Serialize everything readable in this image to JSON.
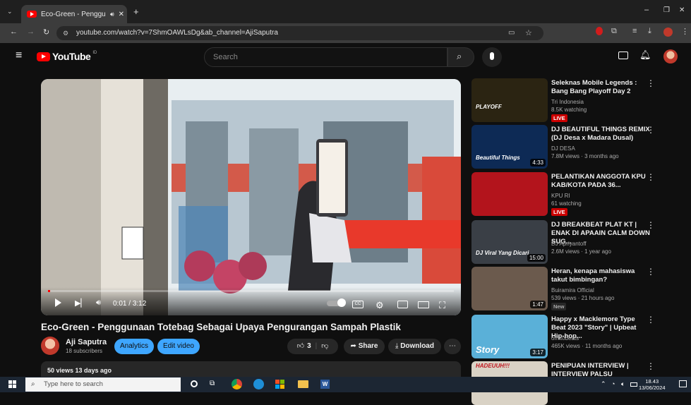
{
  "browser": {
    "tab_title": "Eco-Green - Penggunaan T",
    "url": "youtube.com/watch?v=7ShmOAWLsDg&ab_channel=AjiSaputra"
  },
  "youtube": {
    "logo_text": "YouTube",
    "logo_region": "ID",
    "search_placeholder": "Search"
  },
  "player": {
    "time_current": "0:01",
    "time_total": "3:12",
    "progress_fraction": 0.005
  },
  "video": {
    "title": "Eco-Green - Penggunaan Totebag Sebagai Upaya Pengurangan Sampah Plastik",
    "channel": "Aji Saputra",
    "subscribers": "18 subscribers",
    "analytics_label": "Analytics",
    "edit_label": "Edit video",
    "like_count": "3",
    "share_label": "Share",
    "download_label": "Download",
    "views_date": "50 views  13 days ago"
  },
  "sidebar": [
    {
      "title": "Seleknas Mobile Legends : Bang Bang Playoff Day 2",
      "channel": "Tri Indonesia",
      "stats": "8.5K watching",
      "badge": "LIVE",
      "badge_type": "live",
      "duration": "",
      "thumb_color": "#2b2412"
    },
    {
      "title": "DJ BEAUTIFUL THINGS REMIX (DJ Desa x Madara Dusal)",
      "channel": "DJ DESA",
      "stats": "7.8M views · 3 months ago",
      "badge": "",
      "badge_type": "",
      "duration": "4:33",
      "thumb_color": "#0d2a55"
    },
    {
      "title": "PELANTIKAN ANGGOTA KPU KAB/KOTA PADA 36...",
      "channel": "KPU RI",
      "stats": "61 watching",
      "badge": "LIVE",
      "badge_type": "live",
      "duration": "",
      "thumb_color": "#b3141c"
    },
    {
      "title": "DJ BREAKBEAT PLAT KT | ENAK DI APAAIN CALM DOWN SUG...",
      "channel": "DJ Apriyantoff",
      "stats": "2.6M views · 1 year ago",
      "badge": "",
      "badge_type": "",
      "duration": "15:00",
      "thumb_color": "#3a3f46"
    },
    {
      "title": "Heran, kenapa mahasiswa takut bimbingan?",
      "channel": "Buiramira Official",
      "stats": "539 views · 21 hours ago",
      "badge": "New",
      "badge_type": "new",
      "duration": "1:47",
      "thumb_color": "#6b5a4d"
    },
    {
      "title": "Happy x Macklemore Type Beat 2023 \"Story\" | Upbeat Hip-hop...",
      "channel": "omitobeats",
      "stats": "465K views · 11 months ago",
      "badge": "",
      "badge_type": "",
      "duration": "3:17",
      "thumb_color": "#5ab0d8"
    },
    {
      "title": "PENIPUAN INTERVIEW | INTERVIEW PALSU",
      "channel": "",
      "stats": "",
      "badge": "",
      "badge_type": "",
      "duration": "",
      "thumb_color": "#d9d2c5"
    }
  ],
  "sidebar_thumb_texts": {
    "t0": "PLAYOFF",
    "t1": "Beautiful Things",
    "t3": "DJ Viral Yang Dicari",
    "t5": "Story",
    "t6": "HADEUUH!!!"
  },
  "taskbar": {
    "search_placeholder": "Type here to search",
    "time": "18.43",
    "date": "13/06/2024"
  }
}
